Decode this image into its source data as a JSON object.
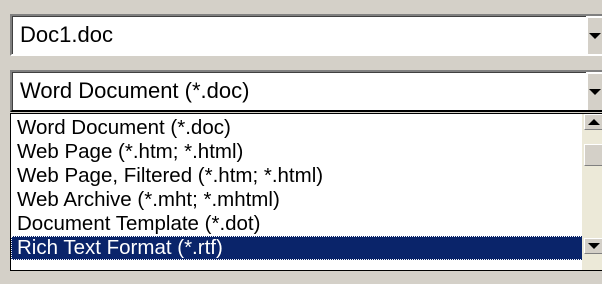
{
  "filename_field": {
    "value": "Doc1.doc"
  },
  "save_as_type": {
    "selected": "Word Document (*.doc)",
    "options": [
      "Word Document (*.doc)",
      "Web Page (*.htm; *.html)",
      "Web Page, Filtered (*.htm; *.html)",
      "Web Archive (*.mht; *.mhtml)",
      "Document Template (*.dot)",
      "Rich Text Format (*.rtf)"
    ],
    "highlighted_option": "Rich Text Format (*.rtf)"
  },
  "colors": {
    "dialog_bg": "#d4d0c8",
    "selection_bg": "#0a246a",
    "selection_text": "#ffffff"
  },
  "icons": [
    "dropdown-arrow-icon",
    "scroll-up-icon",
    "scroll-down-icon"
  ]
}
